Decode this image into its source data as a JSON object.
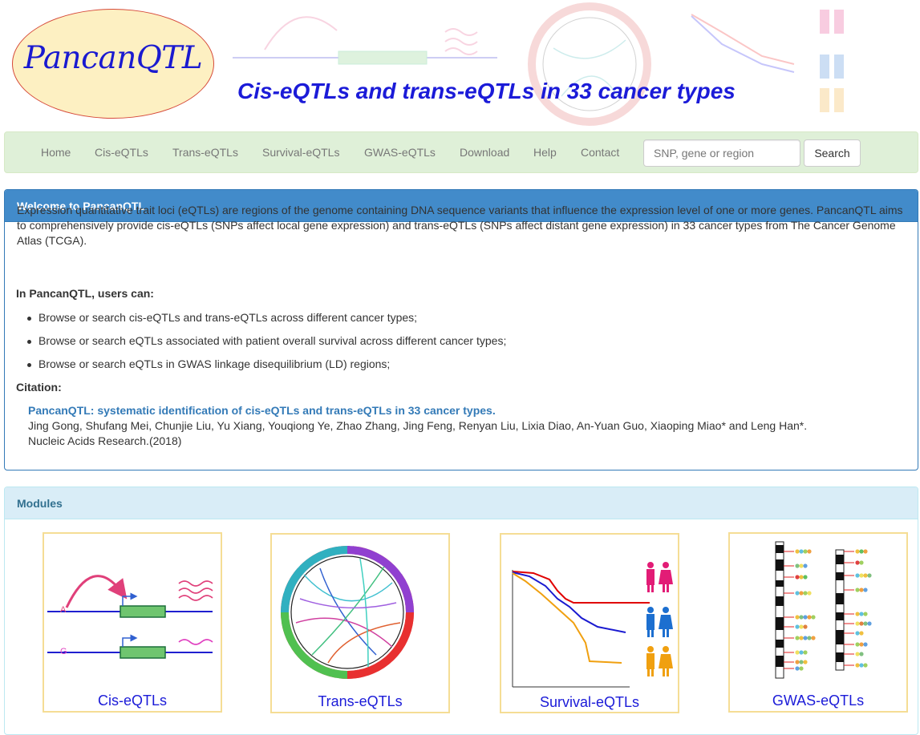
{
  "header": {
    "logo_text": "PancanQTL",
    "tagline": "Cis-eQTLs and trans-eQTLs in 33 cancer types"
  },
  "nav": {
    "items": [
      "Home",
      "Cis-eQTLs",
      "Trans-eQTLs",
      "Survival-eQTLs",
      "GWAS-eQTLs",
      "Download",
      "Help",
      "Contact"
    ],
    "search_placeholder": "SNP, gene or region",
    "search_button": "Search"
  },
  "welcome": {
    "title": "Welcome to PancanQTL",
    "intro": "Expression quantitative trait loci (eQTLs) are regions of the genome containing DNA sequence variants that influence the expression level of one or more genes. PancanQTL aims to comprehensively provide cis-eQTLs (SNPs affect local gene expression) and trans-eQTLs (SNPs affect distant gene expression) in 33 cancer types from The Cancer Genome Atlas (TCGA).",
    "users_can_heading": "In PancanQTL, users can:",
    "bullets": [
      "Browse or search cis-eQTLs and trans-eQTLs across different cancer types;",
      "Browse or search eQTLs associated with patient overall survival across different cancer types;",
      "Browse or search eQTLs in GWAS linkage disequilibrium (LD) regions;"
    ],
    "citation_heading": "Citation:",
    "citation_title": "PancanQTL: systematic identification of cis-eQTLs and trans-eQTLs in 33 cancer types.",
    "citation_authors": "Jing Gong, Shufang Mei, Chunjie Liu, Yu Xiang, Youqiong Ye, Zhao Zhang, Jing Feng, Renyan Liu, Lixia Diao, An-Yuan Guo, Xiaoping Miao* and Leng Han*.",
    "citation_journal": "Nucleic Acids Research.(2018)"
  },
  "modules": {
    "title": "Modules",
    "cards": [
      {
        "label": "Cis-eQTLs",
        "allele_top": "A",
        "allele_bottom": "G"
      },
      {
        "label": "Trans-eQTLs"
      },
      {
        "label": "Survival-eQTLs"
      },
      {
        "label": "GWAS-eQTLs"
      }
    ]
  },
  "colors": {
    "brand_blue": "#1b1bd8",
    "nav_bg": "#dff0d8",
    "primary_panel": "#428bca",
    "info_panel": "#d9edf7",
    "card_border": "#f5dd95",
    "link": "#337ab7"
  }
}
